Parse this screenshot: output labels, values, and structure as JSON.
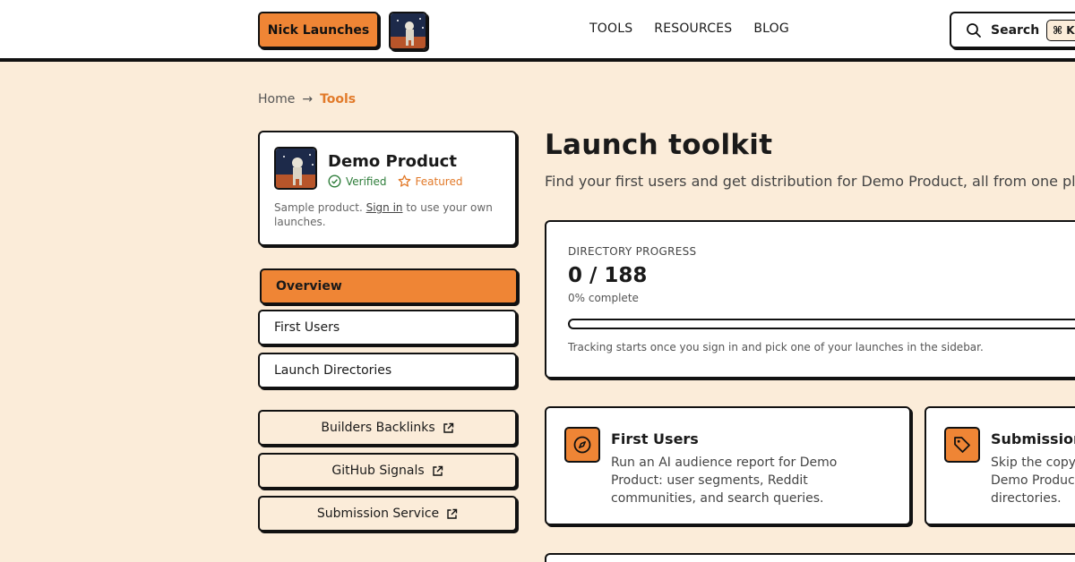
{
  "header": {
    "brand": "Nick Launches",
    "nav": [
      "TOOLS",
      "RESOURCES",
      "BLOG"
    ],
    "search_label": "Search",
    "search_shortcut": "⌘ K"
  },
  "breadcrumb": {
    "home": "Home",
    "separator": "→",
    "current": "Tools"
  },
  "product": {
    "name": "Demo Product",
    "verified": "Verified",
    "featured": "Featured",
    "note_prefix": "Sample product. ",
    "note_link": "Sign in",
    "note_suffix": " to use your own launches."
  },
  "sidebar": {
    "menu": [
      "Overview",
      "First Users",
      "Launch Directories"
    ],
    "external": [
      "Builders Backlinks",
      "GitHub Signals",
      "Submission Service"
    ]
  },
  "main": {
    "title": "Launch toolkit",
    "subtitle": "Find your first users and get distribution for Demo Product, all from one place.",
    "progress": {
      "label": "DIRECTORY PROGRESS",
      "done": 0,
      "count": "0 / 188",
      "percent_text": "0% complete",
      "fraction": 0,
      "note": "Tracking starts once you sign in and pick one of your launches in the sidebar."
    },
    "cards": [
      {
        "title": "First Users",
        "desc": "Run an AI audience report for Demo Product: user segments, Reddit communities, and search queries.",
        "icon": "compass-icon"
      },
      {
        "title": "Submission",
        "desc": "Skip the copy-\nDemo Product\ndirectories.",
        "icon": "tag-icon"
      }
    ]
  },
  "colors": {
    "accent": "#ef8535",
    "background": "#fbecd9",
    "verified": "#2e7d3a"
  }
}
